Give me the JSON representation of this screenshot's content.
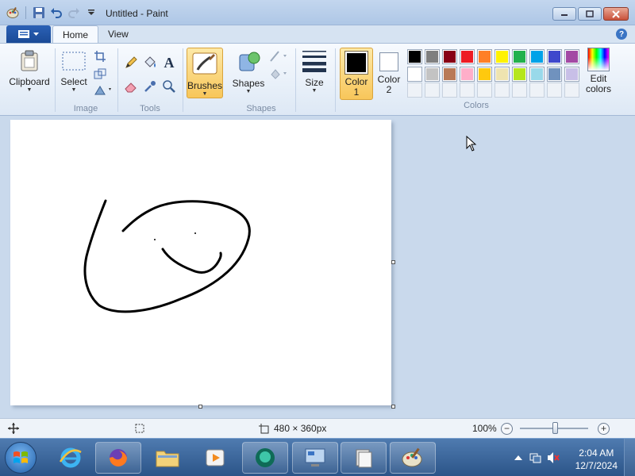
{
  "window": {
    "title": "Untitled - Paint"
  },
  "tabs": {
    "home": "Home",
    "view": "View",
    "help": "?"
  },
  "ribbon": {
    "clipboard": {
      "label": "Clipboard"
    },
    "image": {
      "select_label": "Select",
      "group_label": "Image"
    },
    "tools": {
      "group_label": "Tools",
      "text_tool": "A"
    },
    "brushes": {
      "label": "Brushes"
    },
    "shapes": {
      "label": "Shapes",
      "group_label": "Shapes"
    },
    "size": {
      "label": "Size"
    },
    "colors": {
      "color1_label": "Color",
      "color1_num": "1",
      "color2_label": "Color",
      "color2_num": "2",
      "color1_value": "#000000",
      "color2_value": "#ffffff",
      "edit_label_1": "Edit",
      "edit_label_2": "colors",
      "group_label": "Colors",
      "palette_row1": [
        "#000000",
        "#7f7f7f",
        "#880015",
        "#ed1c24",
        "#ff7f27",
        "#fff200",
        "#22b14c",
        "#00a2e8",
        "#3f48cc",
        "#a349a4"
      ],
      "palette_row2": [
        "#ffffff",
        "#c3c3c3",
        "#b97a57",
        "#ffaec9",
        "#ffc90e",
        "#efe4b0",
        "#b5e61d",
        "#99d9ea",
        "#7092be",
        "#c8bfe7"
      ]
    }
  },
  "canvas": {
    "width": 480,
    "height": 360
  },
  "statusbar": {
    "dimensions": "480 × 360px",
    "zoom": "100%",
    "zoom_level": 1.0
  },
  "taskbar": {
    "time": "2:04 AM",
    "date": "12/7/2024"
  }
}
